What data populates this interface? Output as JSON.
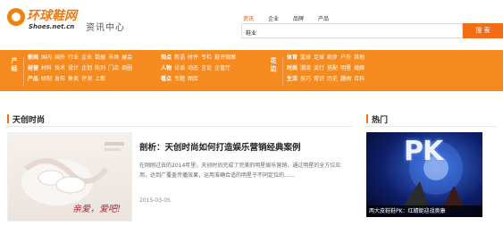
{
  "header": {
    "logo_main": "环球鞋网",
    "logo_sub": "Shoes.net.cn",
    "tagline": "资讯中心",
    "search_tabs": [
      "资讯",
      "企业",
      "品牌",
      "产品"
    ],
    "search_value": "鞋业",
    "search_button": "搜 索"
  },
  "nav": {
    "block1": {
      "head": [
        "产",
        "经"
      ],
      "rows": [
        {
          "key": "新闻",
          "items": [
            "国内",
            "国外",
            "行业",
            "企业",
            "数据",
            "市场",
            "展会"
          ]
        },
        {
          "key": "经营",
          "items": [
            "材料",
            "技术",
            "设计",
            "企划",
            "陈列",
            "门店",
            "商圈"
          ]
        },
        {
          "key": "产品",
          "items": [
            "研制",
            "发布",
            "售卖",
            "评测",
            "上新"
          ]
        }
      ]
    },
    "block2": {
      "rows": [
        {
          "key": "观点",
          "items": [
            "新语",
            "时评",
            "专栏",
            "鞋评观察"
          ]
        },
        {
          "key": "人物",
          "items": [
            "访谈",
            "动态",
            "言论",
            "企管厅"
          ]
        },
        {
          "key": "看点",
          "items": [
            "专题",
            "图库"
          ]
        }
      ]
    },
    "block3": {
      "head": [
        "花",
        "边"
      ],
      "rows": [
        {
          "key": "体育",
          "items": [
            "篮球",
            "足球",
            "跑步",
            "户外",
            "其他"
          ]
        },
        {
          "key": "时尚",
          "items": [
            "潮流",
            "流行",
            "搭配",
            "明星",
            "婚嫁"
          ]
        },
        {
          "key": "生活",
          "items": [
            "技巧",
            "常识",
            "历史",
            "趣闻",
            "百科"
          ]
        }
      ]
    }
  },
  "left": {
    "section_title": "天创时尚",
    "article": {
      "title": "剖析：天创时尚如何打造娱乐营销经典案例",
      "body": "在刚刚过去的2014年里，天创时尚完成了完美的明星娱乐营销，通过明星的全方位应用，达到广覆盖传播效果，运用准确合适的明星于不同定位的……",
      "date": "2015-03-05",
      "thumb_text": "亲爱，爱吧!"
    }
  },
  "right": {
    "section_title": "热门",
    "hot_image_text": "PK",
    "caption": "两大皮鞋鞋PK：红蜻蜓迎战奥康"
  },
  "colors": {
    "brand_orange": "#f58a1f",
    "accent": "#f26d13"
  }
}
